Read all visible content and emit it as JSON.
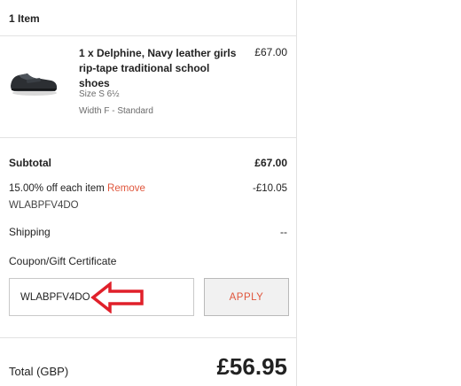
{
  "summary": {
    "items_count": "1 Item"
  },
  "product": {
    "name": "1 x Delphine, Navy leather girls rip-tape traditional school shoes",
    "price": "£67.00",
    "size": "Size S 6½",
    "width": "Width F - Standard",
    "image_icon": "shoe-icon"
  },
  "subtotal": {
    "label": "Subtotal",
    "value": "£67.00"
  },
  "discount": {
    "label": "15.00% off each item",
    "remove_label": "Remove",
    "value": "-£10.05",
    "code": "WLABPFV4DO"
  },
  "shipping": {
    "label": "Shipping",
    "value": "--"
  },
  "coupon": {
    "label": "Coupon/Gift Certificate",
    "value": "WLABPFV4DO",
    "apply_label": "APPLY"
  },
  "total": {
    "label": "Total (GBP)",
    "value": "£56.95"
  },
  "colors": {
    "accent": "#e0563c",
    "annotation": "#e0202a"
  }
}
